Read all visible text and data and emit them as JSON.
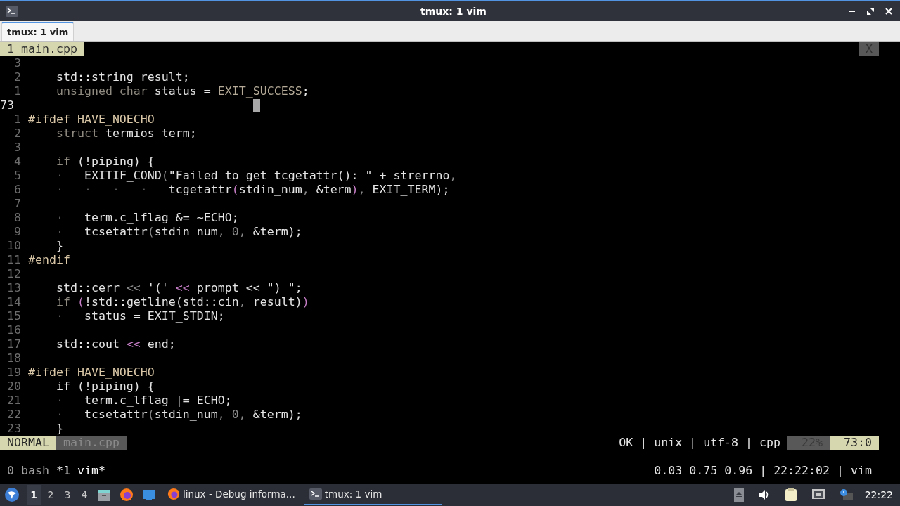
{
  "window": {
    "title": "tmux: 1 vim"
  },
  "tabs": [
    {
      "label": "tmux: 1 vim",
      "selected": true
    }
  ],
  "vim": {
    "tabline": [
      {
        "label": "1 main.cpp",
        "selected": true
      }
    ],
    "close_label": "X",
    "lines": [
      {
        "number": "3",
        "current": false
      },
      {
        "number": "2",
        "current": false,
        "tokens": [
          {
            "kind": "plain",
            "text": "    std::string result;"
          }
        ]
      },
      {
        "number": "1",
        "current": false,
        "tokens": [
          {
            "kind": "keyword",
            "text": "    unsigned char"
          },
          {
            "kind": "plain",
            "text": " status = "
          },
          {
            "kind": "constant",
            "text": "EXIT_SUCCESS"
          },
          {
            "kind": "plain",
            "text": ";"
          }
        ]
      },
      {
        "number": "73",
        "current": true
      },
      {
        "number": "1",
        "current": false,
        "tokens": [
          {
            "kind": "preproc",
            "text": "#ifdef HAVE_NOECHO"
          }
        ]
      },
      {
        "number": "2",
        "current": false,
        "tokens": [
          {
            "kind": "keyword",
            "text": "    struct"
          },
          {
            "kind": "plain",
            "text": " termios term;"
          }
        ]
      },
      {
        "number": "3",
        "current": false
      },
      {
        "number": "4",
        "current": false,
        "tokens": [
          {
            "kind": "keyword",
            "text": "    if"
          },
          {
            "kind": "plain",
            "text": " (!piping) {"
          }
        ]
      },
      {
        "number": "5",
        "current": false,
        "tokens": [
          {
            "kind": "guide",
            "text": "    ·"
          },
          {
            "kind": "plain",
            "text": "   EXITIF_COND"
          },
          {
            "kind": "punct",
            "text": "("
          },
          {
            "kind": "plain",
            "text": "\"Failed to get tcgetattr(): \" + strerrno"
          },
          {
            "kind": "punct",
            "text": ","
          }
        ]
      },
      {
        "number": "6",
        "current": false,
        "tokens": [
          {
            "kind": "guide",
            "text": "    ·   ·   ·   ·"
          },
          {
            "kind": "plain",
            "text": "   tcgetattr"
          },
          {
            "kind": "paren",
            "text": "("
          },
          {
            "kind": "plain",
            "text": "stdin_num"
          },
          {
            "kind": "punct",
            "text": ","
          },
          {
            "kind": "plain",
            "text": " &term"
          },
          {
            "kind": "paren",
            "text": ")"
          },
          {
            "kind": "punct",
            "text": ","
          },
          {
            "kind": "plain",
            "text": " EXIT_TERM);"
          }
        ]
      },
      {
        "number": "7",
        "current": false
      },
      {
        "number": "8",
        "current": false,
        "tokens": [
          {
            "kind": "guide",
            "text": "    ·"
          },
          {
            "kind": "plain",
            "text": "   term.c_lflag &= ~ECHO;"
          }
        ]
      },
      {
        "number": "9",
        "current": false,
        "tokens": [
          {
            "kind": "guide",
            "text": "    ·"
          },
          {
            "kind": "plain",
            "text": "   tcsetattr"
          },
          {
            "kind": "punct",
            "text": "("
          },
          {
            "kind": "plain",
            "text": "stdin_num"
          },
          {
            "kind": "punct",
            "text": ", 0,"
          },
          {
            "kind": "plain",
            "text": " &term);"
          }
        ]
      },
      {
        "number": "10",
        "current": false,
        "tokens": [
          {
            "kind": "plain",
            "text": "    }"
          }
        ]
      },
      {
        "number": "11",
        "current": false,
        "tokens": [
          {
            "kind": "preproc",
            "text": "#endif"
          }
        ]
      },
      {
        "number": "12",
        "current": false
      },
      {
        "number": "13",
        "current": false,
        "tokens": [
          {
            "kind": "plain",
            "text": "    std::cerr "
          },
          {
            "kind": "punct",
            "text": "<<"
          },
          {
            "kind": "plain",
            "text": " '(' "
          },
          {
            "kind": "paren",
            "text": "<<"
          },
          {
            "kind": "plain",
            "text": " prompt << \") \";"
          }
        ]
      },
      {
        "number": "14",
        "current": false,
        "tokens": [
          {
            "kind": "keyword",
            "text": "    if"
          },
          {
            "kind": "paren",
            "text": " ("
          },
          {
            "kind": "plain",
            "text": "!std::getline(std::cin"
          },
          {
            "kind": "punct",
            "text": ","
          },
          {
            "kind": "plain",
            "text": " result)"
          },
          {
            "kind": "paren",
            "text": ")"
          }
        ]
      },
      {
        "number": "15",
        "current": false,
        "tokens": [
          {
            "kind": "guide",
            "text": "    ·"
          },
          {
            "kind": "plain",
            "text": "   status = EXIT_STDIN;"
          }
        ]
      },
      {
        "number": "16",
        "current": false
      },
      {
        "number": "17",
        "current": false,
        "tokens": [
          {
            "kind": "plain",
            "text": "    std::cout "
          },
          {
            "kind": "paren",
            "text": "<<"
          },
          {
            "kind": "plain",
            "text": " end;"
          }
        ]
      },
      {
        "number": "18",
        "current": false
      },
      {
        "number": "19",
        "current": false,
        "tokens": [
          {
            "kind": "preproc",
            "text": "#ifdef HAVE_NOECHO"
          }
        ]
      },
      {
        "number": "20",
        "current": false,
        "tokens": [
          {
            "kind": "plain",
            "text": "    if (!piping) {"
          }
        ]
      },
      {
        "number": "21",
        "current": false,
        "tokens": [
          {
            "kind": "guide",
            "text": "    ·"
          },
          {
            "kind": "plain",
            "text": "   term.c_lflag |= ECHO;"
          }
        ]
      },
      {
        "number": "22",
        "current": false,
        "tokens": [
          {
            "kind": "guide",
            "text": "    ·"
          },
          {
            "kind": "plain",
            "text": "   tcsetattr"
          },
          {
            "kind": "punct",
            "text": "("
          },
          {
            "kind": "plain",
            "text": "stdin_num"
          },
          {
            "kind": "punct",
            "text": ", 0,"
          },
          {
            "kind": "plain",
            "text": " &term);"
          }
        ]
      },
      {
        "number": "23",
        "current": false,
        "tokens": [
          {
            "kind": "plain",
            "text": "    }"
          }
        ]
      }
    ],
    "statusline": {
      "mode": "NORMAL",
      "file": "main.cpp",
      "info": "OK | unix | utf-8 | cpp",
      "percent": "22%",
      "position": "73:0"
    }
  },
  "tmux_status": {
    "windows": [
      {
        "label": "0 bash",
        "selected": false
      },
      {
        "label": "*1 vim*",
        "selected": true
      }
    ],
    "right": "0.03 0.75 0.96 | 22:22:02 | vim"
  },
  "taskbar": {
    "workspaces": [
      {
        "label": "1",
        "selected": true
      },
      {
        "label": "2",
        "selected": false
      },
      {
        "label": "3",
        "selected": false
      },
      {
        "label": "4",
        "selected": false
      }
    ],
    "tasks": [
      {
        "label": "linux - Debug informa...",
        "kind": "browser",
        "selected": false
      },
      {
        "label": "tmux: 1 vim",
        "kind": "terminal",
        "selected": true
      }
    ],
    "clock": "22:22"
  }
}
